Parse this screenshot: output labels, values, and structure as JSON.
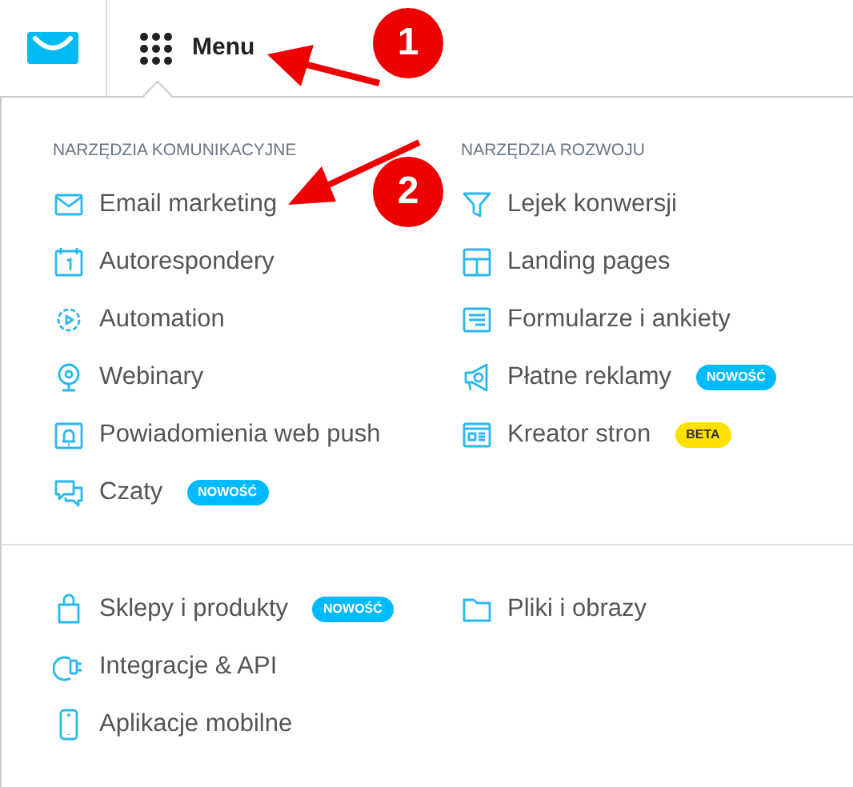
{
  "topbar": {
    "menu_label": "Menu"
  },
  "sections": [
    {
      "columns": [
        {
          "heading": "NARZĘDZIA KOMUNIKACYJNE",
          "items": [
            {
              "label": "Email marketing"
            },
            {
              "label": "Autorespondery"
            },
            {
              "label": "Automation"
            },
            {
              "label": "Webinary"
            },
            {
              "label": "Powiadomienia web push"
            },
            {
              "label": "Czaty",
              "badge": {
                "text": "NOWOŚĆ",
                "kind": "new"
              }
            }
          ]
        },
        {
          "heading": "NARZĘDZIA ROZWOJU",
          "items": [
            {
              "label": "Lejek konwersji"
            },
            {
              "label": "Landing pages"
            },
            {
              "label": "Formularze i ankiety"
            },
            {
              "label": "Płatne reklamy",
              "badge": {
                "text": "NOWOŚĆ",
                "kind": "new"
              }
            },
            {
              "label": "Kreator stron",
              "badge": {
                "text": "BETA",
                "kind": "beta"
              }
            }
          ]
        }
      ]
    },
    {
      "columns": [
        {
          "items": [
            {
              "label": "Sklepy i produkty",
              "badge": {
                "text": "NOWOŚĆ",
                "kind": "new"
              }
            },
            {
              "label": "Integracje & API"
            },
            {
              "label": "Aplikacje mobilne"
            }
          ]
        },
        {
          "items": [
            {
              "label": "Pliki i obrazy"
            }
          ]
        }
      ]
    }
  ],
  "annotations": [
    {
      "label": "1"
    },
    {
      "label": "2"
    }
  ]
}
